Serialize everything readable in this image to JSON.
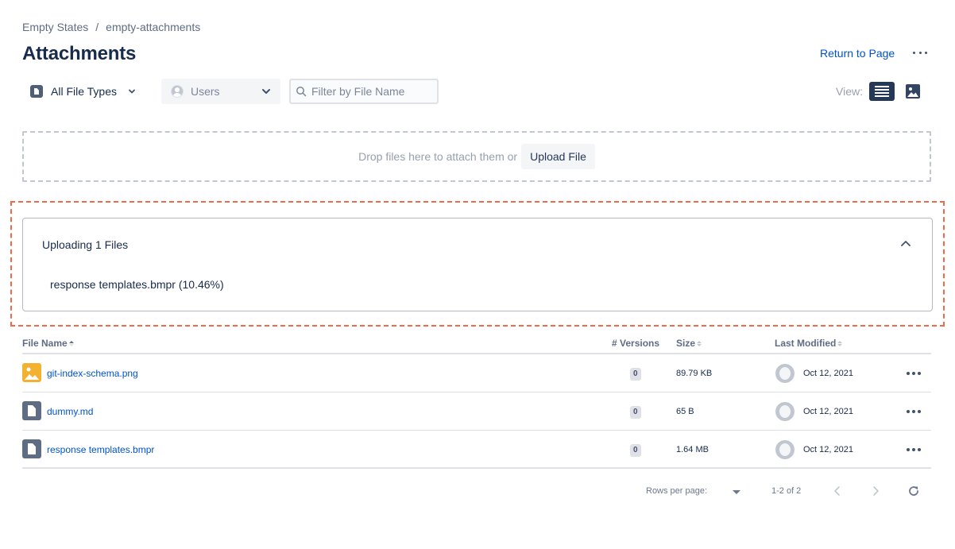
{
  "breadcrumb": {
    "items": [
      "Empty States",
      "empty-attachments"
    ],
    "separator": "/"
  },
  "page_title": "Attachments",
  "header_actions": {
    "return_label": "Return to Page",
    "more_icon": "more-horizontal-icon"
  },
  "toolbar": {
    "file_type_label": "All File Types",
    "users_label": "Users",
    "filter_placeholder": "Filter by File Name",
    "filter_value": "",
    "view_label": "View:",
    "view_mode_selected": "list"
  },
  "dropzone": {
    "text": "Drop files here to attach them or",
    "upload_label": "Upload File"
  },
  "upload_panel": {
    "title": "Uploading 1 Files",
    "items": [
      {
        "name": "response templates.bmpr",
        "progress_text": "(10.46%)",
        "progress_percent": 10.46
      }
    ]
  },
  "table": {
    "columns": {
      "file_name": "File Name",
      "versions": "# Versions",
      "size": "Size",
      "last_modified": "Last Modified"
    },
    "rows": [
      {
        "file_name": "git-index-schema.png",
        "type": "image",
        "versions": "0",
        "size": "89.79 KB",
        "last_modified": "Oct 12, 2021"
      },
      {
        "file_name": "dummy.md",
        "type": "document",
        "versions": "0",
        "size": "65 B",
        "last_modified": "Oct 12, 2021"
      },
      {
        "file_name": "response templates.bmpr",
        "type": "document",
        "versions": "0",
        "size": "1.64 MB",
        "last_modified": "Oct 12, 2021"
      }
    ]
  },
  "pagination": {
    "rows_per_page_label": "Rows per page:",
    "range": "1-2 of 2"
  },
  "colors": {
    "accent": "#0052cc",
    "highlight": "#f06a4a",
    "image_icon": "#f3b12f",
    "doc_icon": "#5e6c84"
  }
}
